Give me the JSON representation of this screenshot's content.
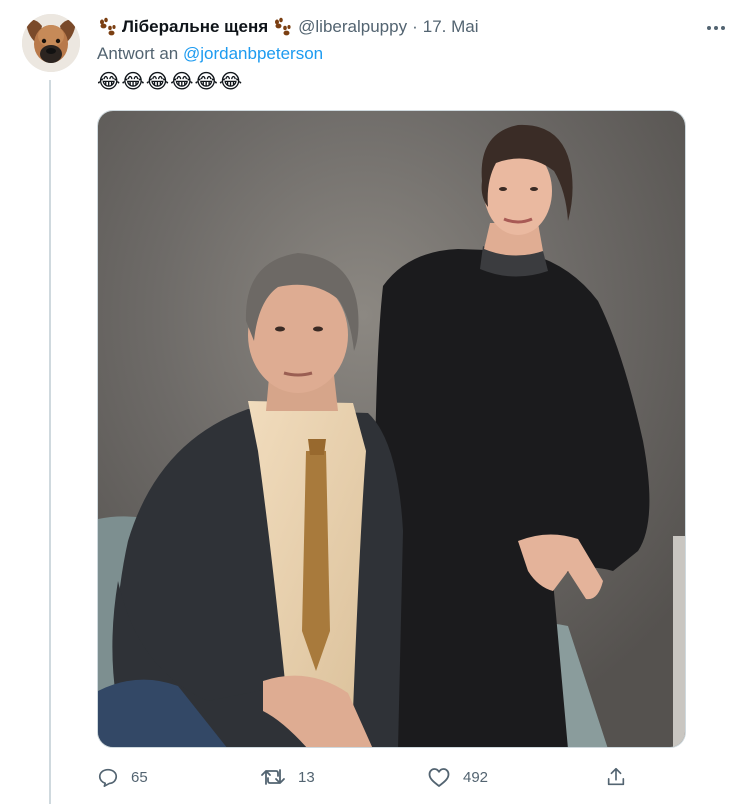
{
  "tweet": {
    "display_name": "Ліберальне щеня",
    "handle": "@liberalpuppy",
    "separator": "·",
    "date": "17. Mai",
    "reply_prefix": "Antwort an",
    "reply_to": "@jordanbpeterson",
    "text": "😂😂😂😂😂😂",
    "icons": {
      "name_prefix": "paw-prints-icon",
      "name_suffix": "paw-prints-icon",
      "more": "more-horizontal-icon"
    },
    "avatar_alt": "dog avatar",
    "media_alt": "photo of a man and a woman posing on a sofa"
  },
  "actions": {
    "reply": {
      "icon": "reply-icon",
      "count": "65"
    },
    "retweet": {
      "icon": "retweet-icon",
      "count": "13"
    },
    "like": {
      "icon": "heart-icon",
      "count": "492"
    },
    "share": {
      "icon": "share-icon",
      "count": ""
    }
  },
  "colors": {
    "text": "#0f1419",
    "muted": "#536471",
    "link": "#1d9bf0",
    "border": "#cfd9de"
  }
}
